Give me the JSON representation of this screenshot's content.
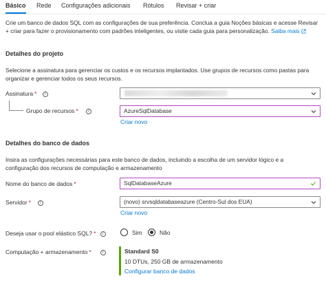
{
  "tabs": [
    {
      "label": "Básico",
      "active": true
    },
    {
      "label": "Rede",
      "active": false
    },
    {
      "label": "Configurações adicionais",
      "active": false
    },
    {
      "label": "Rótulos",
      "active": false
    },
    {
      "label": "Revisar + criar",
      "active": false
    }
  ],
  "intro": {
    "line1": "Crie um banco de dados SQL com as configurações de sua preferência. Conclua a guia Noções básicas e acesse Revisar",
    "line2": "+ criar para fazer o provisionamento com padrões inteligentes, ou visite cada guia para personalização.",
    "learn_more": "Saiba mais"
  },
  "project": {
    "heading": "Detalhes do projeto",
    "desc1": "Selecione a assinatura para gerenciar os custos e os recursos implantados. Use grupos de recursos como pastas para",
    "desc2": "organizar e gerenciar todos os seus recursos.",
    "subscription_label": "Assinatura",
    "resource_group_label": "Grupo de recursos",
    "resource_group_value": "AzureSqlDatabase",
    "create_new": "Criar novo"
  },
  "database": {
    "heading": "Detalhes do banco de dados",
    "desc1": "Insira as configurações necessárias para este banco de dados, incluindo a escolha de um servidor lógico e a",
    "desc2": "configuração dos recursos de computação e armazenamento",
    "name_label": "Nome do banco de dados",
    "name_value": "SqlDatabaseAzure",
    "server_label": "Servidor",
    "server_value": "(novo) srvsqldatabaseazure (Centro-Sul dos EUA)",
    "create_new": "Criar novo",
    "elastic_label": "Deseja usar o pool elástico SQL?",
    "elastic_yes": "Sim",
    "elastic_no": "Não",
    "elastic_selected": "Não",
    "compute_label": "Computação + armazenamento",
    "compute_tier": "Standard S0",
    "compute_detail": "10 DTUs, 250 GB de armazenamento",
    "configure_link": "Configurar banco de dados"
  },
  "required_marker": "*",
  "colors": {
    "accent": "#0078d4",
    "required": "#a4262c",
    "highlight_border": "#b146c2",
    "valid": "#57a300"
  }
}
